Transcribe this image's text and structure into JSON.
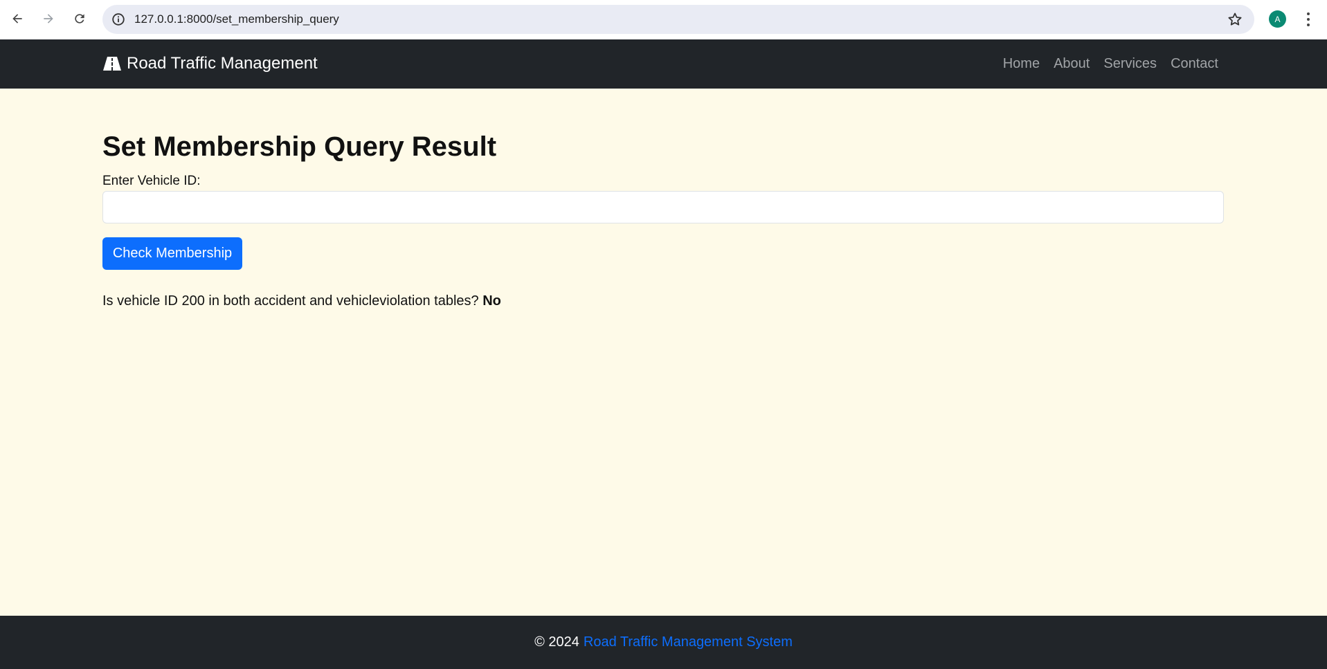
{
  "browser": {
    "url": "127.0.0.1:8000/set_membership_query",
    "avatar_letter": "A"
  },
  "navbar": {
    "brand": "Road Traffic Management",
    "links": [
      "Home",
      "About",
      "Services",
      "Contact"
    ]
  },
  "main": {
    "title": "Set Membership Query Result",
    "input_label": "Enter Vehicle ID:",
    "input_value": "",
    "button_label": "Check Membership",
    "result_question": "Is vehicle ID 200 in both accident and vehicleviolation tables?",
    "result_answer": "No"
  },
  "footer": {
    "copyright": "© 2024",
    "link_text": "Road Traffic Management System"
  },
  "colors": {
    "page_bg": "#fefae8",
    "navbar_bg": "#212529",
    "primary": "#0d6efd"
  }
}
